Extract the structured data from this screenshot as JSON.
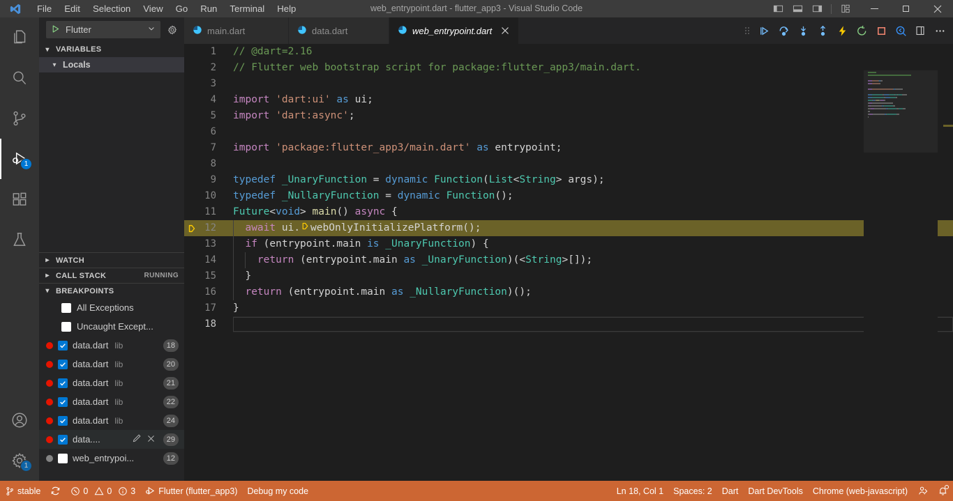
{
  "window": {
    "title": "web_entrypoint.dart - flutter_app3 - Visual Studio Code",
    "logo_icon": "vscode-logo",
    "menus": [
      "File",
      "Edit",
      "Selection",
      "View",
      "Go",
      "Run",
      "Terminal",
      "Help"
    ],
    "layout_controls": [
      {
        "name": "toggle-primary-sidebar-icon",
        "label": "Toggle Primary Side Bar"
      },
      {
        "name": "toggle-panel-icon",
        "label": "Toggle Panel"
      },
      {
        "name": "toggle-secondary-sidebar-icon",
        "label": "Toggle Secondary Side Bar"
      },
      {
        "name": "customize-layout-icon",
        "label": "Customize Layout"
      }
    ],
    "controls": [
      {
        "name": "minimize-button",
        "glyph": "minimize"
      },
      {
        "name": "maximize-button",
        "glyph": "maximize"
      },
      {
        "name": "close-button",
        "glyph": "close"
      }
    ]
  },
  "activitybar": {
    "items": [
      {
        "name": "explorer",
        "icon": "files-icon",
        "label": "Explorer",
        "active": false,
        "badge": null
      },
      {
        "name": "search",
        "icon": "search-icon",
        "label": "Search",
        "active": false,
        "badge": null
      },
      {
        "name": "source-control",
        "icon": "source-control-icon",
        "label": "Source Control",
        "active": false,
        "badge": null
      },
      {
        "name": "run-and-debug",
        "icon": "run-debug-icon",
        "label": "Run and Debug",
        "active": true,
        "badge": "1"
      },
      {
        "name": "extensions",
        "icon": "extensions-icon",
        "label": "Extensions",
        "active": false,
        "badge": null
      },
      {
        "name": "testing",
        "icon": "beaker-icon",
        "label": "Testing",
        "active": false,
        "badge": null
      }
    ],
    "bottom": [
      {
        "name": "accounts",
        "icon": "account-icon",
        "label": "Accounts",
        "badge": null
      },
      {
        "name": "manage",
        "icon": "gear-icon",
        "label": "Manage",
        "badge": "1"
      }
    ]
  },
  "sidebar": {
    "launch": {
      "play_icon": "play-icon",
      "config_name": "Flutter",
      "chevron_icon": "chevron-down-icon",
      "settings_icon": "debug-configure-gear-icon"
    },
    "sections": [
      {
        "name": "variables",
        "title": "VARIABLES",
        "expanded": true,
        "tag": ""
      },
      {
        "name": "watch",
        "title": "WATCH",
        "expanded": false,
        "tag": ""
      },
      {
        "name": "call-stack",
        "title": "CALL STACK",
        "expanded": false,
        "tag": "RUNNING"
      },
      {
        "name": "breakpoints",
        "title": "BREAKPOINTS",
        "expanded": true,
        "tag": ""
      }
    ],
    "variables": {
      "scope_label": "Locals",
      "expanded": true
    },
    "breakpoints": {
      "exceptions": [
        {
          "label": "All Exceptions",
          "checked": false
        },
        {
          "label": "Uncaught Except...",
          "checked": false
        }
      ],
      "items": [
        {
          "file": "data.dart",
          "path": "lib",
          "line": "18",
          "checked": true,
          "enabled": true,
          "selected": false
        },
        {
          "file": "data.dart",
          "path": "lib",
          "line": "20",
          "checked": true,
          "enabled": true,
          "selected": false
        },
        {
          "file": "data.dart",
          "path": "lib",
          "line": "21",
          "checked": true,
          "enabled": true,
          "selected": false
        },
        {
          "file": "data.dart",
          "path": "lib",
          "line": "22",
          "checked": true,
          "enabled": true,
          "selected": false
        },
        {
          "file": "data.dart",
          "path": "lib",
          "line": "24",
          "checked": true,
          "enabled": true,
          "selected": false
        },
        {
          "file": "data....",
          "path": "",
          "line": "29",
          "checked": true,
          "enabled": true,
          "selected": true,
          "actions": [
            "edit-condition-icon",
            "remove-breakpoint-icon"
          ]
        },
        {
          "file": "web_entrypoi...",
          "path": "",
          "line": "12",
          "checked": false,
          "enabled": false,
          "selected": false
        }
      ]
    }
  },
  "editor": {
    "tabs": [
      {
        "label": "main.dart",
        "icon": "dart-file-icon",
        "active": false,
        "italic": false,
        "closable": false
      },
      {
        "label": "data.dart",
        "icon": "dart-file-icon",
        "active": false,
        "italic": false,
        "closable": false
      },
      {
        "label": "web_entrypoint.dart",
        "icon": "dart-file-icon",
        "active": true,
        "italic": true,
        "closable": true
      }
    ],
    "debug_toolbar": [
      {
        "name": "drag-handle-icon",
        "label": "Drag"
      },
      {
        "name": "continue-icon",
        "label": "Continue",
        "color": "#75beff"
      },
      {
        "name": "step-over-icon",
        "label": "Step Over",
        "color": "#75beff"
      },
      {
        "name": "step-into-icon",
        "label": "Step Into",
        "color": "#75beff"
      },
      {
        "name": "step-out-icon",
        "label": "Step Out",
        "color": "#75beff"
      },
      {
        "name": "hot-reload-icon",
        "label": "Hot Reload",
        "color": "#ffcc00"
      },
      {
        "name": "hot-restart-icon",
        "label": "Hot Restart",
        "color": "#89d185"
      },
      {
        "name": "stop-icon",
        "label": "Stop",
        "color": "#f48771"
      },
      {
        "name": "inspect-widget-icon",
        "label": "Inspect Widget",
        "color": "#3794ff"
      },
      {
        "name": "open-devtools-icon",
        "label": "Open DevTools",
        "color": "#cccccc"
      },
      {
        "name": "more-actions-icon",
        "label": "More Actions...",
        "color": "#cccccc"
      }
    ],
    "exec_line": 12,
    "cursor_line": 18,
    "lines": [
      {
        "n": "1",
        "tokens": [
          {
            "t": "// @dart=2.16",
            "c": "c-comment"
          }
        ]
      },
      {
        "n": "2",
        "tokens": [
          {
            "t": "// Flutter web bootstrap script for package:flutter_app3/main.dart.",
            "c": "c-comment"
          }
        ]
      },
      {
        "n": "3",
        "tokens": []
      },
      {
        "n": "4",
        "tokens": [
          {
            "t": "import ",
            "c": "c-ctrl"
          },
          {
            "t": "'dart:ui'",
            "c": "c-str"
          },
          {
            "t": " ",
            "c": "c-plain"
          },
          {
            "t": "as",
            "c": "c-kw"
          },
          {
            "t": " ui;",
            "c": "c-plain"
          }
        ]
      },
      {
        "n": "5",
        "tokens": [
          {
            "t": "import ",
            "c": "c-ctrl"
          },
          {
            "t": "'dart:async'",
            "c": "c-str"
          },
          {
            "t": ";",
            "c": "c-plain"
          }
        ]
      },
      {
        "n": "6",
        "tokens": []
      },
      {
        "n": "7",
        "tokens": [
          {
            "t": "import ",
            "c": "c-ctrl"
          },
          {
            "t": "'package:flutter_app3/main.dart'",
            "c": "c-str"
          },
          {
            "t": " ",
            "c": "c-plain"
          },
          {
            "t": "as",
            "c": "c-kw"
          },
          {
            "t": " entrypoint;",
            "c": "c-plain"
          }
        ]
      },
      {
        "n": "8",
        "tokens": []
      },
      {
        "n": "9",
        "tokens": [
          {
            "t": "typedef",
            "c": "c-kw"
          },
          {
            "t": " _UnaryFunction ",
            "c": "c-type"
          },
          {
            "t": "= ",
            "c": "c-plain"
          },
          {
            "t": "dynamic ",
            "c": "c-kw"
          },
          {
            "t": "Function",
            "c": "c-type"
          },
          {
            "t": "(",
            "c": "c-plain"
          },
          {
            "t": "List",
            "c": "c-type"
          },
          {
            "t": "<",
            "c": "c-plain"
          },
          {
            "t": "String",
            "c": "c-type"
          },
          {
            "t": "> args);",
            "c": "c-plain"
          }
        ]
      },
      {
        "n": "10",
        "tokens": [
          {
            "t": "typedef",
            "c": "c-kw"
          },
          {
            "t": " _NullaryFunction ",
            "c": "c-type"
          },
          {
            "t": "= ",
            "c": "c-plain"
          },
          {
            "t": "dynamic ",
            "c": "c-kw"
          },
          {
            "t": "Function",
            "c": "c-type"
          },
          {
            "t": "();",
            "c": "c-plain"
          }
        ]
      },
      {
        "n": "11",
        "tokens": [
          {
            "t": "Future",
            "c": "c-type"
          },
          {
            "t": "<",
            "c": "c-plain"
          },
          {
            "t": "void",
            "c": "c-kw"
          },
          {
            "t": "> ",
            "c": "c-plain"
          },
          {
            "t": "main",
            "c": "c-fn"
          },
          {
            "t": "() ",
            "c": "c-plain"
          },
          {
            "t": "async",
            "c": "c-ctrl"
          },
          {
            "t": " {",
            "c": "c-plain"
          }
        ]
      },
      {
        "n": "12",
        "tokens": [
          {
            "t": "  ",
            "c": "c-plain"
          },
          {
            "t": "await",
            "c": "c-ctrl"
          },
          {
            "t": " ui.",
            "c": "c-plain"
          },
          {
            "t": "@BP@",
            "c": "bp-inline"
          },
          {
            "t": "webOnlyInitializePlatform();",
            "c": "c-plain"
          }
        ]
      },
      {
        "n": "13",
        "tokens": [
          {
            "t": "  ",
            "c": "c-plain"
          },
          {
            "t": "if",
            "c": "c-ctrl"
          },
          {
            "t": " (entrypoint.main ",
            "c": "c-plain"
          },
          {
            "t": "is",
            "c": "c-kw"
          },
          {
            "t": " ",
            "c": "c-plain"
          },
          {
            "t": "_UnaryFunction",
            "c": "c-type"
          },
          {
            "t": ") {",
            "c": "c-plain"
          }
        ]
      },
      {
        "n": "14",
        "tokens": [
          {
            "t": "    ",
            "c": "c-plain"
          },
          {
            "t": "return",
            "c": "c-ctrl"
          },
          {
            "t": " (entrypoint.main ",
            "c": "c-plain"
          },
          {
            "t": "as",
            "c": "c-kw"
          },
          {
            "t": " ",
            "c": "c-plain"
          },
          {
            "t": "_UnaryFunction",
            "c": "c-type"
          },
          {
            "t": ")(<",
            "c": "c-plain"
          },
          {
            "t": "String",
            "c": "c-type"
          },
          {
            "t": ">[]);",
            "c": "c-plain"
          }
        ]
      },
      {
        "n": "15",
        "tokens": [
          {
            "t": "  }",
            "c": "c-plain"
          }
        ]
      },
      {
        "n": "16",
        "tokens": [
          {
            "t": "  ",
            "c": "c-plain"
          },
          {
            "t": "return",
            "c": "c-ctrl"
          },
          {
            "t": " (entrypoint.main ",
            "c": "c-plain"
          },
          {
            "t": "as",
            "c": "c-kw"
          },
          {
            "t": " ",
            "c": "c-plain"
          },
          {
            "t": "_NullaryFunction",
            "c": "c-type"
          },
          {
            "t": ")();",
            "c": "c-plain"
          }
        ]
      },
      {
        "n": "17",
        "tokens": [
          {
            "t": "}",
            "c": "c-plain"
          }
        ]
      },
      {
        "n": "18",
        "tokens": []
      }
    ]
  },
  "statusbar": {
    "background": "#cc6633",
    "left": [
      {
        "name": "remote-branch",
        "icon": "source-control-icon",
        "label": "stable"
      },
      {
        "name": "sync-changes",
        "icon": "sync-icon",
        "label": ""
      },
      {
        "name": "problems",
        "icon": "error-warning-info-icons",
        "label": "0  0  3",
        "errors": "0",
        "warnings": "0",
        "infos": "3"
      },
      {
        "name": "debug-session",
        "icon": "debug-alt-icon",
        "label": "Flutter (flutter_app3)"
      },
      {
        "name": "debug-my-code",
        "icon": "",
        "label": "Debug my code"
      }
    ],
    "right": [
      {
        "name": "editor-position",
        "label": "Ln 18, Col 1"
      },
      {
        "name": "editor-indentation",
        "label": "Spaces: 2"
      },
      {
        "name": "editor-language",
        "label": "Dart"
      },
      {
        "name": "dart-devtools",
        "label": "Dart DevTools"
      },
      {
        "name": "flutter-device",
        "label": "Chrome (web-javascript)"
      },
      {
        "name": "live-share",
        "icon": "live-share-icon",
        "label": ""
      },
      {
        "name": "notifications",
        "icon": "bell-icon",
        "label": ""
      }
    ]
  }
}
